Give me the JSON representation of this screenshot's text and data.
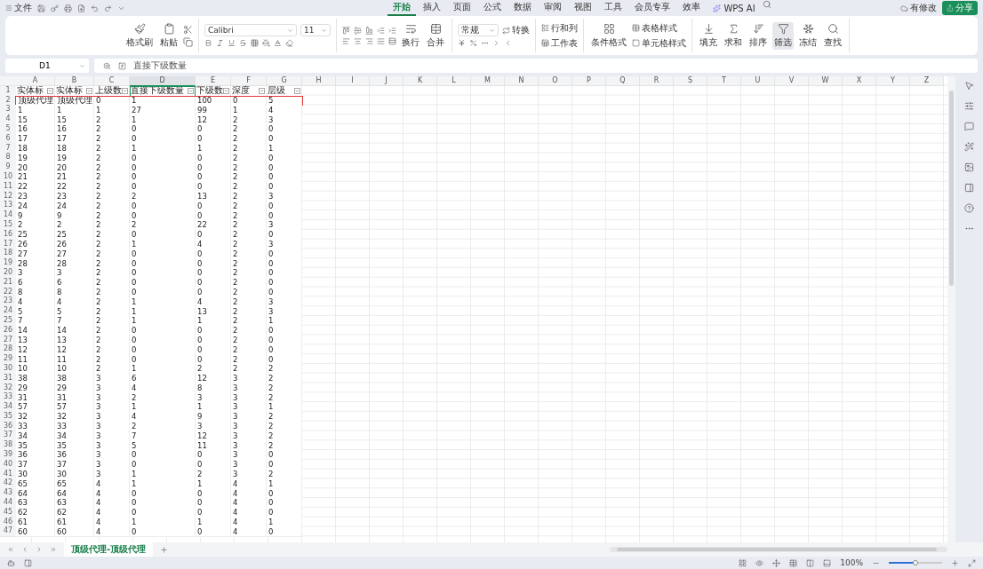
{
  "toolbar": {
    "file_label": "文件",
    "tabs": [
      {
        "label": "开始",
        "selected": true
      },
      {
        "label": "插入",
        "selected": false
      },
      {
        "label": "页面",
        "selected": false
      },
      {
        "label": "公式",
        "selected": false
      },
      {
        "label": "数据",
        "selected": false
      },
      {
        "label": "审阅",
        "selected": false
      },
      {
        "label": "视图",
        "selected": false
      },
      {
        "label": "工具",
        "selected": false
      },
      {
        "label": "会员专享",
        "selected": false
      },
      {
        "label": "效率",
        "selected": false
      }
    ],
    "ai_label": "WPS AI",
    "status_label": "有修改",
    "share_label": "分享"
  },
  "ribbon": {
    "clipboard": [
      "格式刷",
      "粘贴"
    ],
    "font_name": "Calibri",
    "font_size": "11",
    "wrap_label": "换行",
    "merge_label": "合并",
    "number_format": "常规",
    "convert_label": "转换",
    "rows_cols_label": "行和列",
    "sheet_label": "工作表",
    "conditional_label": "条件格式",
    "table_style_label": "表格样式",
    "cell_style_label": "单元格样式",
    "tools": [
      {
        "label": "填充",
        "active": false
      },
      {
        "label": "求和",
        "active": false
      },
      {
        "label": "排序",
        "active": false
      },
      {
        "label": "筛选",
        "active": true
      },
      {
        "label": "冻结",
        "active": false
      },
      {
        "label": "查找",
        "active": false
      }
    ]
  },
  "formula_bar": {
    "cell_ref": "D1",
    "formula": "直接下级数量"
  },
  "sheet": {
    "columns": [
      {
        "label": "A",
        "selected": false
      },
      {
        "label": "B",
        "selected": false
      },
      {
        "label": "C",
        "selected": false
      },
      {
        "label": "D",
        "selected": true
      },
      {
        "label": "E",
        "selected": false
      },
      {
        "label": "F",
        "selected": false
      },
      {
        "label": "G",
        "selected": false
      },
      {
        "label": "H",
        "selected": false
      },
      {
        "label": "I",
        "selected": false
      },
      {
        "label": "J",
        "selected": false
      },
      {
        "label": "K",
        "selected": false
      },
      {
        "label": "L",
        "selected": false
      },
      {
        "label": "M",
        "selected": false
      },
      {
        "label": "N",
        "selected": false
      },
      {
        "label": "O",
        "selected": false
      },
      {
        "label": "P",
        "selected": false
      },
      {
        "label": "Q",
        "selected": false
      },
      {
        "label": "R",
        "selected": false
      },
      {
        "label": "S",
        "selected": false
      },
      {
        "label": "T",
        "selected": false
      },
      {
        "label": "U",
        "selected": false
      },
      {
        "label": "V",
        "selected": false
      },
      {
        "label": "W",
        "selected": false
      },
      {
        "label": "X",
        "selected": false
      },
      {
        "label": "Y",
        "selected": false
      },
      {
        "label": "Z",
        "selected": false
      }
    ],
    "header_row": {
      "number": "1",
      "cells": [
        "实体标",
        "实体标",
        "上级数",
        "直接下级数量",
        "下级数",
        "深度",
        "层级"
      ]
    },
    "rows": [
      {
        "number": "2",
        "outlined": true,
        "cells": [
          "顶级代理",
          "顶级代理",
          "0",
          "1",
          "100",
          "0",
          "5"
        ]
      },
      {
        "number": "3",
        "outlined": false,
        "cells": [
          "1",
          "1",
          "1",
          "27",
          "99",
          "1",
          "4"
        ]
      },
      {
        "number": "4",
        "outlined": false,
        "cells": [
          "15",
          "15",
          "2",
          "1",
          "12",
          "2",
          "3"
        ]
      },
      {
        "number": "5",
        "outlined": false,
        "cells": [
          "16",
          "16",
          "2",
          "0",
          "0",
          "2",
          "0"
        ]
      },
      {
        "number": "6",
        "outlined": false,
        "cells": [
          "17",
          "17",
          "2",
          "0",
          "0",
          "2",
          "0"
        ]
      },
      {
        "number": "7",
        "outlined": false,
        "cells": [
          "18",
          "18",
          "2",
          "1",
          "1",
          "2",
          "1"
        ]
      },
      {
        "number": "8",
        "outlined": false,
        "cells": [
          "19",
          "19",
          "2",
          "0",
          "0",
          "2",
          "0"
        ]
      },
      {
        "number": "9",
        "outlined": false,
        "cells": [
          "20",
          "20",
          "2",
          "0",
          "0",
          "2",
          "0"
        ]
      },
      {
        "number": "10",
        "outlined": false,
        "cells": [
          "21",
          "21",
          "2",
          "0",
          "0",
          "2",
          "0"
        ]
      },
      {
        "number": "11",
        "outlined": false,
        "cells": [
          "22",
          "22",
          "2",
          "0",
          "0",
          "2",
          "0"
        ]
      },
      {
        "number": "12",
        "outlined": false,
        "cells": [
          "23",
          "23",
          "2",
          "2",
          "13",
          "2",
          "3"
        ]
      },
      {
        "number": "13",
        "outlined": false,
        "cells": [
          "24",
          "24",
          "2",
          "0",
          "0",
          "2",
          "0"
        ]
      },
      {
        "number": "14",
        "outlined": false,
        "cells": [
          "9",
          "9",
          "2",
          "0",
          "0",
          "2",
          "0"
        ]
      },
      {
        "number": "15",
        "outlined": false,
        "cells": [
          "2",
          "2",
          "2",
          "2",
          "22",
          "2",
          "3"
        ]
      },
      {
        "number": "16",
        "outlined": false,
        "cells": [
          "25",
          "25",
          "2",
          "0",
          "0",
          "2",
          "0"
        ]
      },
      {
        "number": "17",
        "outlined": false,
        "cells": [
          "26",
          "26",
          "2",
          "1",
          "4",
          "2",
          "3"
        ]
      },
      {
        "number": "18",
        "outlined": false,
        "cells": [
          "27",
          "27",
          "2",
          "0",
          "0",
          "2",
          "0"
        ]
      },
      {
        "number": "19",
        "outlined": false,
        "cells": [
          "28",
          "28",
          "2",
          "0",
          "0",
          "2",
          "0"
        ]
      },
      {
        "number": "20",
        "outlined": false,
        "cells": [
          "3",
          "3",
          "2",
          "0",
          "0",
          "2",
          "0"
        ]
      },
      {
        "number": "21",
        "outlined": false,
        "cells": [
          "6",
          "6",
          "2",
          "0",
          "0",
          "2",
          "0"
        ]
      },
      {
        "number": "22",
        "outlined": false,
        "cells": [
          "8",
          "8",
          "2",
          "0",
          "0",
          "2",
          "0"
        ]
      },
      {
        "number": "23",
        "outlined": false,
        "cells": [
          "4",
          "4",
          "2",
          "1",
          "4",
          "2",
          "3"
        ]
      },
      {
        "number": "24",
        "outlined": false,
        "cells": [
          "5",
          "5",
          "2",
          "1",
          "13",
          "2",
          "3"
        ]
      },
      {
        "number": "25",
        "outlined": false,
        "cells": [
          "7",
          "7",
          "2",
          "1",
          "1",
          "2",
          "1"
        ]
      },
      {
        "number": "26",
        "outlined": false,
        "cells": [
          "14",
          "14",
          "2",
          "0",
          "0",
          "2",
          "0"
        ]
      },
      {
        "number": "27",
        "outlined": false,
        "cells": [
          "13",
          "13",
          "2",
          "0",
          "0",
          "2",
          "0"
        ]
      },
      {
        "number": "28",
        "outlined": false,
        "cells": [
          "12",
          "12",
          "2",
          "0",
          "0",
          "2",
          "0"
        ]
      },
      {
        "number": "29",
        "outlined": false,
        "cells": [
          "11",
          "11",
          "2",
          "0",
          "0",
          "2",
          "0"
        ]
      },
      {
        "number": "30",
        "outlined": false,
        "cells": [
          "10",
          "10",
          "2",
          "1",
          "2",
          "2",
          "2"
        ]
      },
      {
        "number": "31",
        "outlined": false,
        "cells": [
          "38",
          "38",
          "3",
          "6",
          "12",
          "3",
          "2"
        ]
      },
      {
        "number": "32",
        "outlined": false,
        "cells": [
          "29",
          "29",
          "3",
          "4",
          "8",
          "3",
          "2"
        ]
      },
      {
        "number": "33",
        "outlined": false,
        "cells": [
          "31",
          "31",
          "3",
          "2",
          "3",
          "3",
          "2"
        ]
      },
      {
        "number": "34",
        "outlined": false,
        "cells": [
          "57",
          "57",
          "3",
          "1",
          "1",
          "3",
          "1"
        ]
      },
      {
        "number": "35",
        "outlined": false,
        "cells": [
          "32",
          "32",
          "3",
          "4",
          "9",
          "3",
          "2"
        ]
      },
      {
        "number": "36",
        "outlined": false,
        "cells": [
          "33",
          "33",
          "3",
          "2",
          "3",
          "3",
          "2"
        ]
      },
      {
        "number": "37",
        "outlined": false,
        "cells": [
          "34",
          "34",
          "3",
          "7",
          "12",
          "3",
          "2"
        ]
      },
      {
        "number": "38",
        "outlined": false,
        "cells": [
          "35",
          "35",
          "3",
          "5",
          "11",
          "3",
          "2"
        ]
      },
      {
        "number": "39",
        "outlined": false,
        "cells": [
          "36",
          "36",
          "3",
          "0",
          "0",
          "3",
          "0"
        ]
      },
      {
        "number": "40",
        "outlined": false,
        "cells": [
          "37",
          "37",
          "3",
          "0",
          "0",
          "3",
          "0"
        ]
      },
      {
        "number": "41",
        "outlined": false,
        "cells": [
          "30",
          "30",
          "3",
          "1",
          "2",
          "3",
          "2"
        ]
      },
      {
        "number": "42",
        "outlined": false,
        "cells": [
          "65",
          "65",
          "4",
          "1",
          "1",
          "4",
          "1"
        ]
      },
      {
        "number": "43",
        "outlined": false,
        "cells": [
          "64",
          "64",
          "4",
          "0",
          "0",
          "4",
          "0"
        ]
      },
      {
        "number": "44",
        "outlined": false,
        "cells": [
          "63",
          "63",
          "4",
          "0",
          "0",
          "4",
          "0"
        ]
      },
      {
        "number": "45",
        "outlined": false,
        "cells": [
          "62",
          "62",
          "4",
          "0",
          "0",
          "4",
          "0"
        ]
      },
      {
        "number": "46",
        "outlined": false,
        "cells": [
          "61",
          "61",
          "4",
          "1",
          "1",
          "4",
          "1"
        ]
      },
      {
        "number": "47",
        "outlined": false,
        "cells": [
          "60",
          "60",
          "4",
          "0",
          "0",
          "4",
          "0"
        ]
      }
    ]
  },
  "sheet_tabs": [
    {
      "label": "顶级代理-顶级代理",
      "selected": true
    }
  ],
  "status_bar": {
    "zoom": "100%",
    "zoom_slider": {
      "level": 0.5
    }
  }
}
